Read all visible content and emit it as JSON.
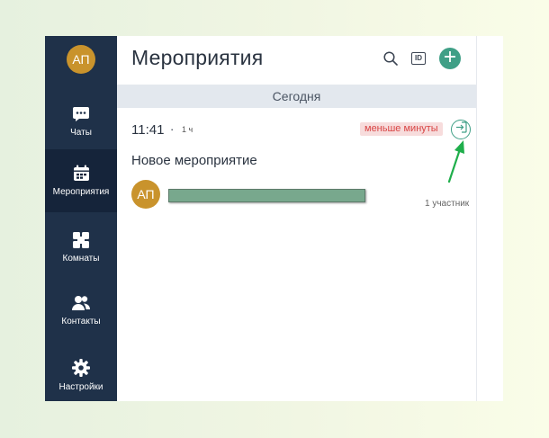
{
  "sidebar": {
    "avatar_initials": "АП",
    "items": [
      {
        "label": "Чаты",
        "icon": "chat-icon"
      },
      {
        "label": "Мероприятия",
        "icon": "calendar-icon",
        "active": true
      },
      {
        "label": "Комнаты",
        "icon": "rooms-icon"
      },
      {
        "label": "Контакты",
        "icon": "contacts-icon"
      },
      {
        "label": "Настройки",
        "icon": "gear-icon"
      }
    ]
  },
  "header": {
    "title": "Мероприятия",
    "icons": [
      "search-icon",
      "id-icon",
      "plus-icon"
    ],
    "id_badge": "ID"
  },
  "date_group": "Сегодня",
  "event": {
    "time": "11:41",
    "separator": "·",
    "duration": "1 ч",
    "badge": "меньше минуты",
    "name": "Новое мероприятие",
    "owner_initials": "АП",
    "participants": "1 участник"
  },
  "colors": {
    "sidebar": "#1f3149",
    "sidebar_active": "#15243a",
    "accent": "#3f9f86",
    "avatar": "#c9932c",
    "badge_bg": "#f7dcdc",
    "badge_text": "#d84444",
    "annotation_arrow": "#1fae4b"
  }
}
